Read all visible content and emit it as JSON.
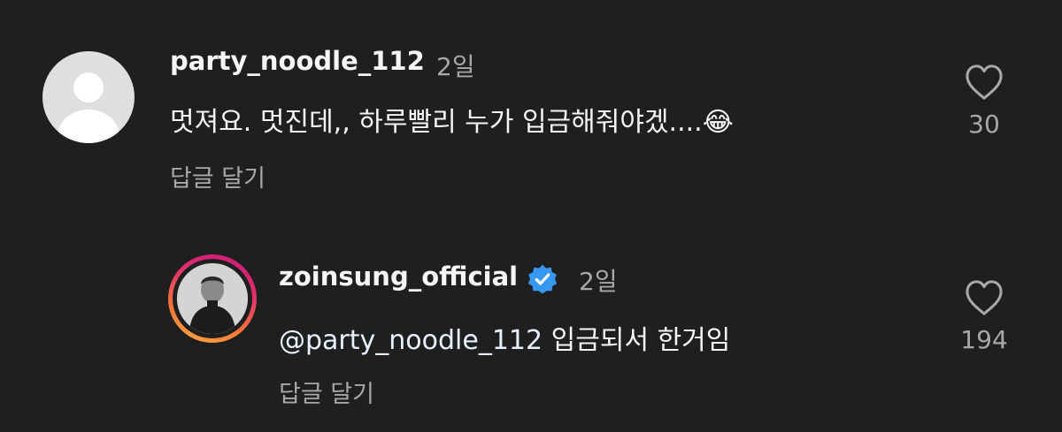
{
  "comments": [
    {
      "username": "party_noodle_112",
      "time": "2일",
      "text": "멋져요. 멋진데,, 하루빨리 누가 입금해줘야겠....😂",
      "reply_label": "답글 달기",
      "likes": "30"
    }
  ],
  "reply": {
    "username": "zoinsung_official",
    "verified": true,
    "time": "2일",
    "mention": "@party_noodle_112",
    "text": " 입금되서 한거임",
    "reply_label": "답글 달기",
    "likes": "194"
  },
  "colors": {
    "background": "#1f1f20",
    "verified_badge": "#3897f0",
    "secondary_text": "#a8a8a8"
  },
  "icons": {
    "like": "heart-outline-icon",
    "verified": "verified-badge-icon"
  }
}
